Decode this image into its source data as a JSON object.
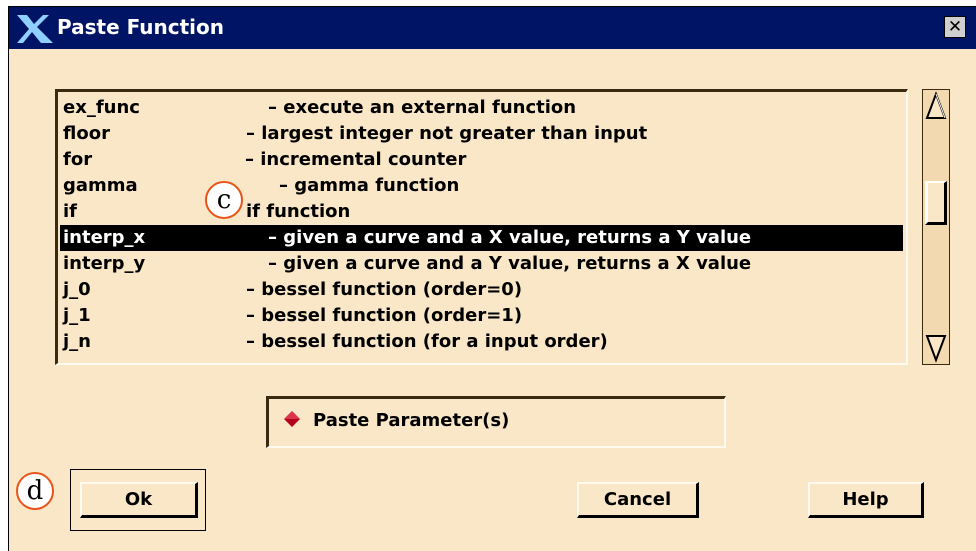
{
  "window": {
    "title": "Paste Function",
    "close_label": "✕"
  },
  "list": {
    "items": [
      {
        "name": "ex_func",
        "desc": "– execute an external function"
      },
      {
        "name": "floor",
        "desc": "– largest integer not greater than input"
      },
      {
        "name": "for",
        "desc": "– incremental counter"
      },
      {
        "name": "gamma",
        "desc": "– gamma function"
      },
      {
        "name": "if",
        "desc": "if function"
      },
      {
        "name": "interp_x",
        "desc": "– given a curve and a X value, returns a Y value",
        "selected": true
      },
      {
        "name": "interp_y",
        "desc": "– given a curve and a Y value, returns a X value"
      },
      {
        "name": "j_0",
        "desc": "– bessel function (order=0)"
      },
      {
        "name": "j_1",
        "desc": "– bessel function (order=1)"
      },
      {
        "name": "j_n",
        "desc": "– bessel function (for a input order)"
      }
    ]
  },
  "param": {
    "label": "Paste Parameter(s)"
  },
  "buttons": {
    "ok": "Ok",
    "cancel": "Cancel",
    "help": "Help"
  },
  "annotations": {
    "c": "c",
    "d": "d"
  },
  "colors": {
    "titlebar": "#001466",
    "background": "#f9e7c7",
    "selection": "#000000",
    "diamond": "#b3001b",
    "annotation_border": "#e8541a"
  }
}
